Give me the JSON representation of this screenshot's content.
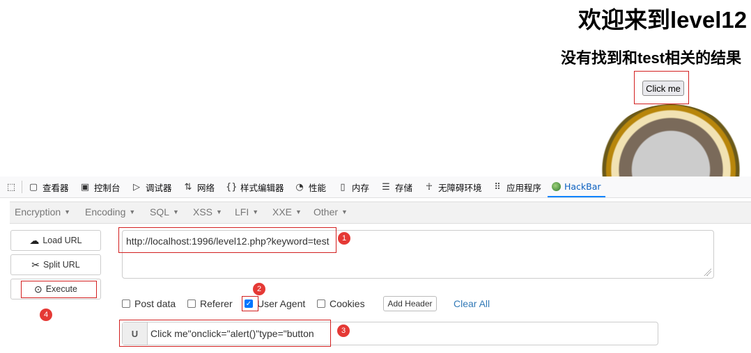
{
  "page": {
    "title": "欢迎来到level12",
    "subtitle": "没有找到和test相关的结果",
    "button_label": "Click me"
  },
  "devtools": {
    "tabs": [
      {
        "label": "查看器",
        "icon": "inspector-icon"
      },
      {
        "label": "控制台",
        "icon": "console-icon"
      },
      {
        "label": "调试器",
        "icon": "debugger-icon"
      },
      {
        "label": "网络",
        "icon": "network-icon"
      },
      {
        "label": "样式编辑器",
        "icon": "style-editor-icon"
      },
      {
        "label": "性能",
        "icon": "performance-icon"
      },
      {
        "label": "内存",
        "icon": "memory-icon"
      },
      {
        "label": "存储",
        "icon": "storage-icon"
      },
      {
        "label": "无障碍环境",
        "icon": "accessibility-icon"
      },
      {
        "label": "应用程序",
        "icon": "application-icon"
      },
      {
        "label": "HackBar",
        "icon": "hackbar-icon",
        "active": true
      }
    ]
  },
  "hackbar": {
    "menus": [
      "Encryption",
      "Encoding",
      "SQL",
      "XSS",
      "LFI",
      "XXE",
      "Other"
    ],
    "load_url": "Load URL",
    "split_url": "Split URL",
    "execute": "Execute",
    "url_value": "http://localhost:1996/level12.php?keyword=test",
    "options": {
      "post_data": "Post data",
      "referer": "Referer",
      "user_agent": "User Agent",
      "cookies": "Cookies"
    },
    "user_agent_checked": true,
    "add_header": "Add Header",
    "clear_all": "Clear All",
    "ua_prefix": "U",
    "ua_value": "Click me\"onclick=\"alert()\"type=\"button"
  },
  "annotations": {
    "badges": [
      "1",
      "2",
      "3",
      "4"
    ]
  },
  "colors": {
    "annotation_red": "#e53935",
    "highlight_box": "#d21f1f",
    "checkbox_blue": "#0075ff",
    "link_blue": "#337ab7"
  }
}
